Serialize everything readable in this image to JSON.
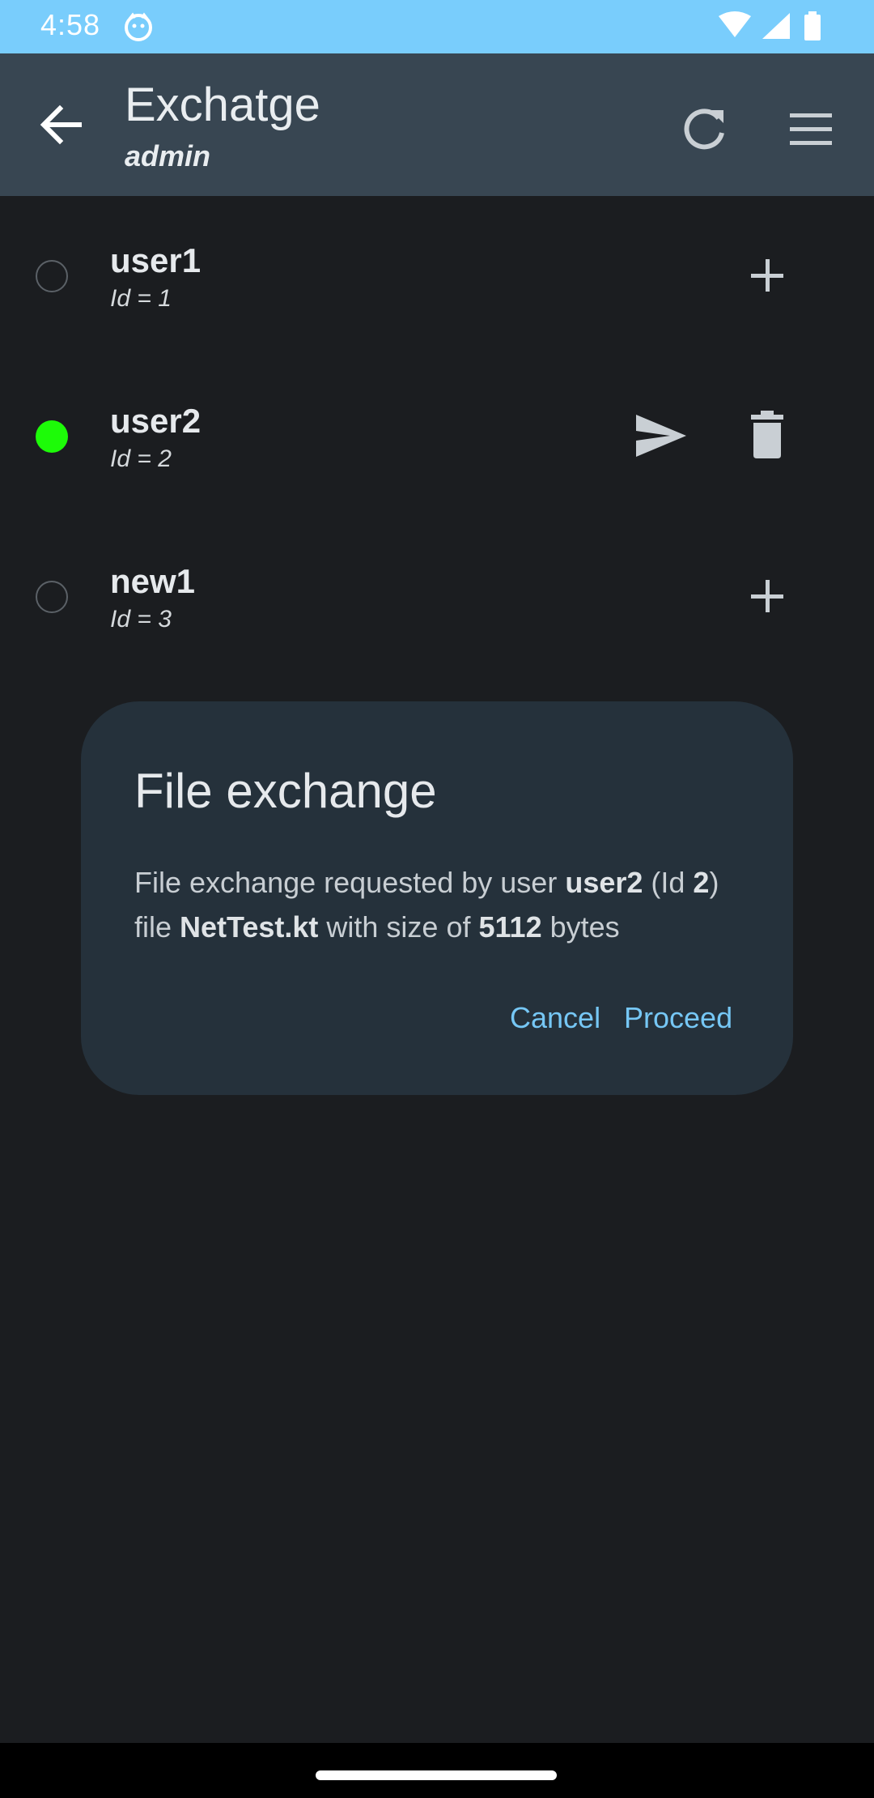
{
  "status_bar": {
    "time": "4:58"
  },
  "app_bar": {
    "title": "Exchatge",
    "subtitle": "admin"
  },
  "users": [
    {
      "name": "user1",
      "id_label": "Id = 1",
      "online": false
    },
    {
      "name": "user2",
      "id_label": "Id = 2",
      "online": true
    },
    {
      "name": "new1",
      "id_label": "Id = 3",
      "online": false
    }
  ],
  "dialog": {
    "title": "File exchange",
    "message": {
      "part1": "File exchange requested by user ",
      "user": "user2",
      "part2": " (Id ",
      "id": "2",
      "part3": ") file ",
      "file": "NetTest.kt",
      "part4": " with size of ",
      "size": "5112",
      "part5": " bytes"
    },
    "cancel_label": "Cancel",
    "proceed_label": "Proceed"
  },
  "colors": {
    "status_bar": "#79cdfc",
    "app_bar": "#384652",
    "background": "#1b1d20",
    "dialog": "#25313b",
    "accent": "#76c7f5",
    "online": "#1dfb08"
  },
  "icons": {
    "back": "arrow-left-icon",
    "refresh": "refresh-icon",
    "menu": "hamburger-menu-icon",
    "add": "plus-icon",
    "send": "send-icon",
    "delete": "trash-icon"
  }
}
